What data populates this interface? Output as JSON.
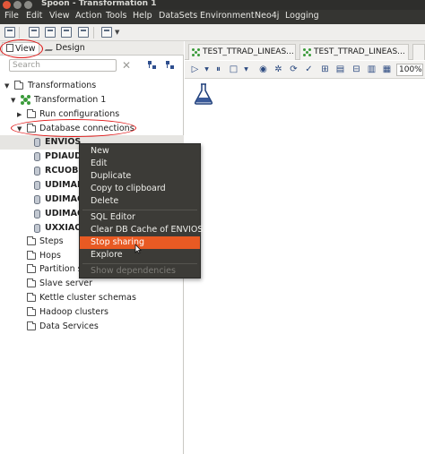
{
  "window": {
    "title": "Spoon - Transformation 1"
  },
  "menubar": [
    "File",
    "Edit",
    "View",
    "Action",
    "Tools",
    "Help",
    "DataSets",
    "Environment",
    "Neo4j",
    "Logging"
  ],
  "left_panel": {
    "tabs": {
      "view": "View",
      "design": "Design"
    },
    "search_placeholder": "Search",
    "tree": {
      "root": "Transformations",
      "transformation": "Transformation 1",
      "run_configurations": "Run configurations",
      "database_connections": "Database connections",
      "connections": [
        "ENVIOS",
        "PDIAUDI",
        "RCUOBIE",
        "UDIMAD",
        "UDIMAO",
        "UDIMAO",
        "UXXIACF"
      ],
      "folders": [
        "Steps",
        "Hops",
        "Partition sc",
        "Slave server",
        "Kettle cluster schemas",
        "Hadoop clusters",
        "Data Services"
      ]
    }
  },
  "editor": {
    "tabs": [
      "TEST_TTRAD_LINEAS...",
      "TEST_TTRAD_LINEAS..."
    ],
    "zoom": "100%"
  },
  "context_menu": {
    "group1": [
      "New",
      "Edit",
      "Duplicate",
      "Copy to clipboard",
      "Delete"
    ],
    "group2": [
      "SQL Editor",
      "Clear DB Cache of ENVIOS",
      "Stop sharing",
      "Explore"
    ],
    "group3": [
      "Show dependencies"
    ],
    "highlighted": "Stop sharing"
  },
  "colors": {
    "menu_bg": "#3c3b37",
    "highlight": "#e85a23",
    "annotation_red": "#e01818"
  }
}
